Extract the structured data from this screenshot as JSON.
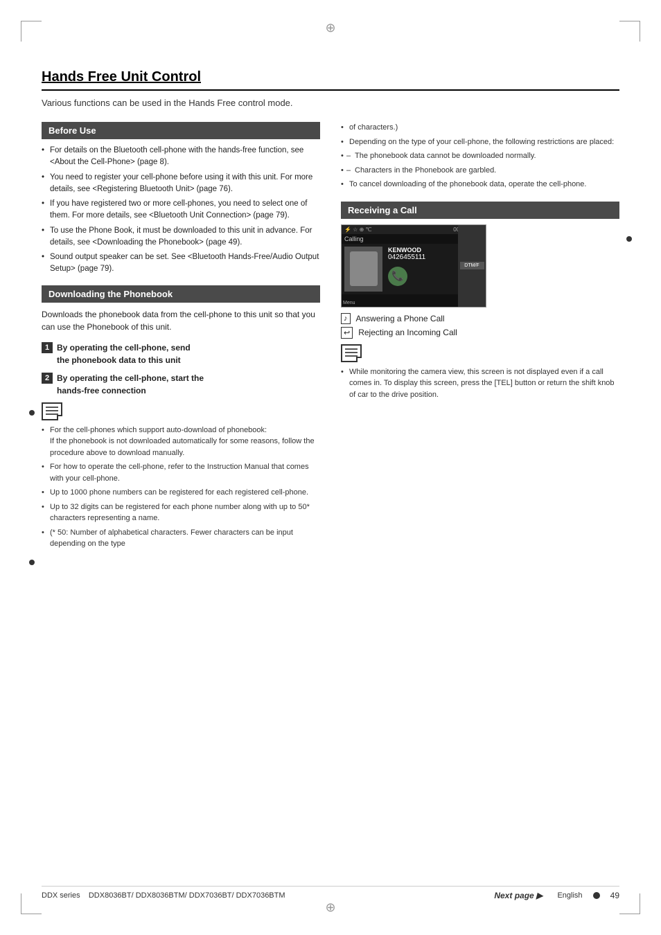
{
  "page": {
    "title": "Hands Free Unit Control",
    "subtitle": "Various functions can be used in the Hands Free control mode.",
    "footer": {
      "series_label": "DDX series",
      "models": "DDX8036BT/ DDX8036BTM/ DDX7036BT/ DDX7036BTM",
      "next_page": "Next page ▶",
      "language": "English",
      "page_number": "49"
    }
  },
  "before_use": {
    "heading": "Before Use",
    "bullets": [
      "For details on the Bluetooth cell-phone with the hands-free function, see <About the Cell-Phone> (page 8).",
      "You need to register your cell-phone before using it with this unit. For more details, see <Registering Bluetooth Unit> (page 76).",
      "If you have registered two or more cell-phones, you need to select one of them. For more details, see <Bluetooth Unit Connection> (page 79).",
      "To use the Phone Book, it must be downloaded to this unit in advance. For details, see <Downloading the Phonebook> (page 49).",
      "Sound output speaker can be set. See <Bluetooth Hands-Free/Audio Output Setup> (page 79)."
    ]
  },
  "downloading": {
    "heading": "Downloading the Phonebook",
    "description": "Downloads the phonebook data from the cell-phone to this unit so that you can use the Phonebook of this unit.",
    "steps": [
      {
        "number": "1",
        "text": "By operating the cell-phone, send the phonebook data to this unit"
      },
      {
        "number": "2",
        "text": "By operating the cell-phone, start the hands-free connection"
      }
    ],
    "notes": [
      "For the cell-phones which support auto-download of phonebook:",
      "If the phonebook is not downloaded automatically for some reasons, follow the procedure above to download manually.",
      "For how to operate the cell-phone, refer to the Instruction Manual that comes with your cell-phone.",
      "Up to 1000 phone numbers can be registered for each registered cell-phone.",
      "Up to 32 digits can be registered for each phone number along with up to 50* characters representing a name.",
      "(* 50: Number of alphabetical characters. Fewer characters can be input depending on the type"
    ]
  },
  "right_column_notes": [
    "of characters.)",
    "Depending on the type of your cell-phone, the following restrictions are placed:",
    "The phonebook data cannot be downloaded normally.",
    "Characters in the Phonebook are garbled.",
    "To cancel downloading of the phonebook data, operate the cell-phone."
  ],
  "receiving": {
    "heading": "Receiving a Call",
    "screen": {
      "calling_label": "Calling",
      "name": "KENWOOD",
      "number": "0426455111",
      "menu_label": "Menu",
      "side_buttons": [
        "DTM/F"
      ]
    },
    "actions": [
      {
        "icon": "[ ♪ ]",
        "label": "Answering a Phone Call"
      },
      {
        "icon": "[ ↩ ]",
        "label": "Rejecting an Incoming Call"
      }
    ],
    "note": "While monitoring the camera view, this screen is not displayed even if a call comes in. To display this screen, press the [TEL] button or return the shift knob of car to the drive position."
  }
}
